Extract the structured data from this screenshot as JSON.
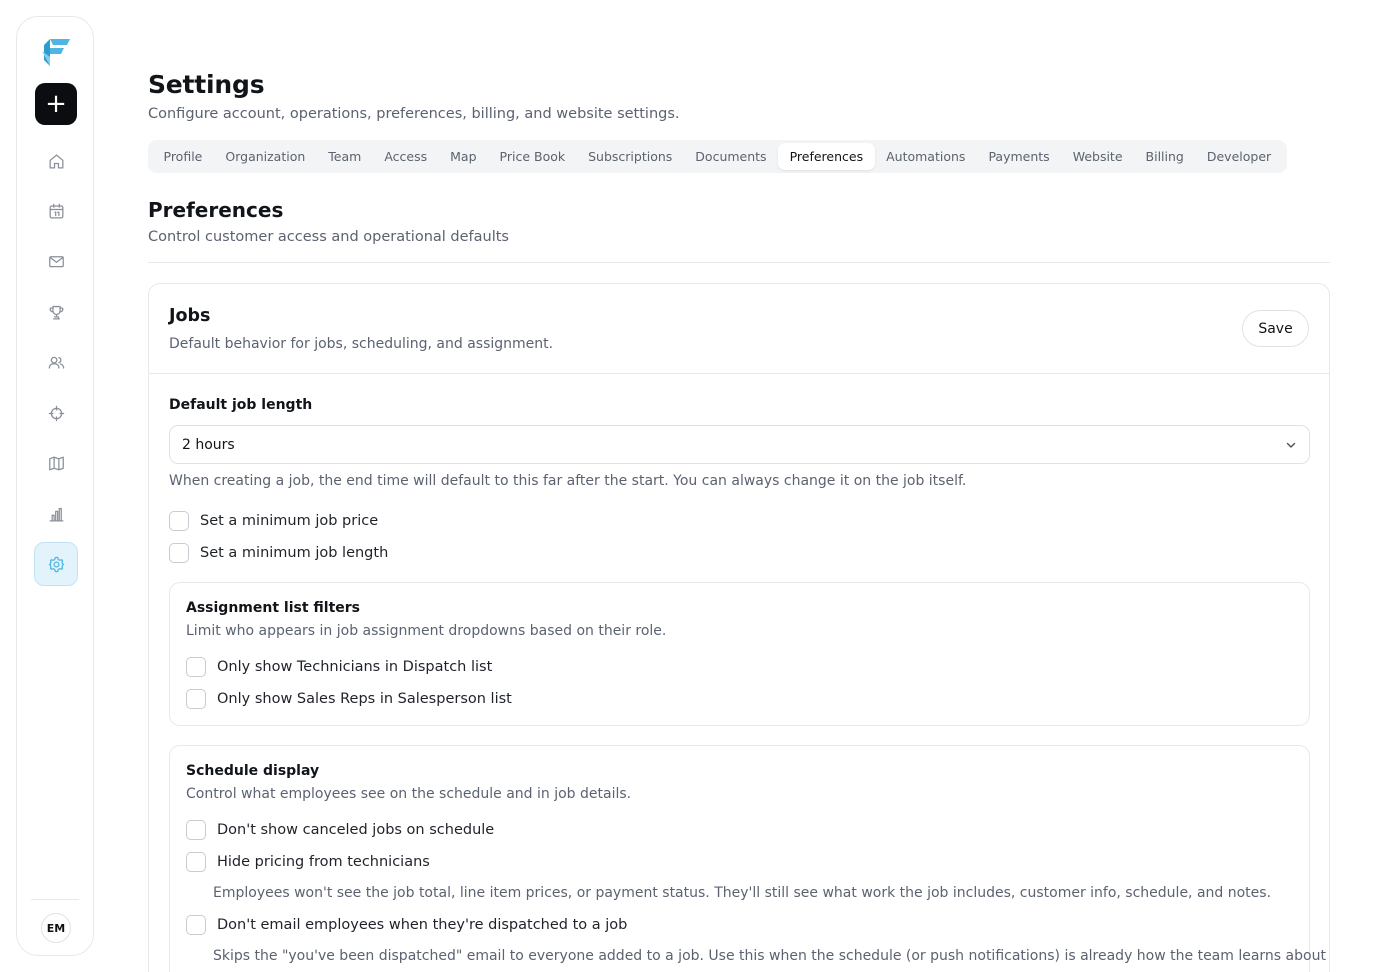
{
  "brand": {
    "name": "F",
    "accent": "#4fb6e3",
    "dark": "#0b0d10"
  },
  "rail": {
    "new_label": "+",
    "nav": [
      {
        "name": "home-icon",
        "active": false
      },
      {
        "name": "calendar-icon",
        "active": false
      },
      {
        "name": "mail-icon",
        "active": false
      },
      {
        "name": "trophy-icon",
        "active": false
      },
      {
        "name": "users-icon",
        "active": false
      },
      {
        "name": "crosshair-icon",
        "active": false
      },
      {
        "name": "map-icon",
        "active": false
      },
      {
        "name": "bar-chart-icon",
        "active": false
      },
      {
        "name": "gear-icon",
        "active": true
      }
    ],
    "avatar": "EM"
  },
  "header": {
    "title": "Settings",
    "subtitle": "Configure account, operations, preferences, billing, and website settings."
  },
  "tabs": [
    {
      "label": "Profile",
      "active": false
    },
    {
      "label": "Organization",
      "active": false
    },
    {
      "label": "Team",
      "active": false
    },
    {
      "label": "Access",
      "active": false
    },
    {
      "label": "Map",
      "active": false
    },
    {
      "label": "Price Book",
      "active": false
    },
    {
      "label": "Subscriptions",
      "active": false
    },
    {
      "label": "Documents",
      "active": false
    },
    {
      "label": "Preferences",
      "active": true
    },
    {
      "label": "Automations",
      "active": false
    },
    {
      "label": "Payments",
      "active": false
    },
    {
      "label": "Website",
      "active": false
    },
    {
      "label": "Billing",
      "active": false
    },
    {
      "label": "Developer",
      "active": false
    }
  ],
  "section": {
    "title": "Preferences",
    "subtitle": "Control customer access and operational defaults"
  },
  "jobs": {
    "title": "Jobs",
    "subtitle": "Default behavior for jobs, scheduling, and assignment.",
    "save_label": "Save",
    "default_length_label": "Default job length",
    "default_length_value": "2 hours",
    "default_length_help": "When creating a job, the end time will default to this far after the start. You can always change it on the job itself.",
    "min_price_label": "Set a minimum job price",
    "min_length_label": "Set a minimum job length",
    "assignment": {
      "title": "Assignment list filters",
      "description": "Limit who appears in job assignment dropdowns based on their role.",
      "opt_technicians": "Only show Technicians in Dispatch list",
      "opt_sales_reps": "Only show Sales Reps in Salesperson list"
    },
    "schedule": {
      "title": "Schedule display",
      "description": "Control what employees see on the schedule and in job details.",
      "opt_canceled": "Don't show canceled jobs on schedule",
      "opt_hide_pricing": "Hide pricing from technicians",
      "hide_pricing_help": "Employees won't see the job total, line item prices, or payment status. They'll still see what work the job includes, customer info, schedule, and notes.",
      "opt_no_dispatch_email": "Don't email employees when they're dispatched to a job",
      "no_dispatch_email_help": "Skips the \"you've been dispatched\" email to everyone added to a job. Use this when the schedule (or push notifications) is already how the team learns about"
    }
  }
}
